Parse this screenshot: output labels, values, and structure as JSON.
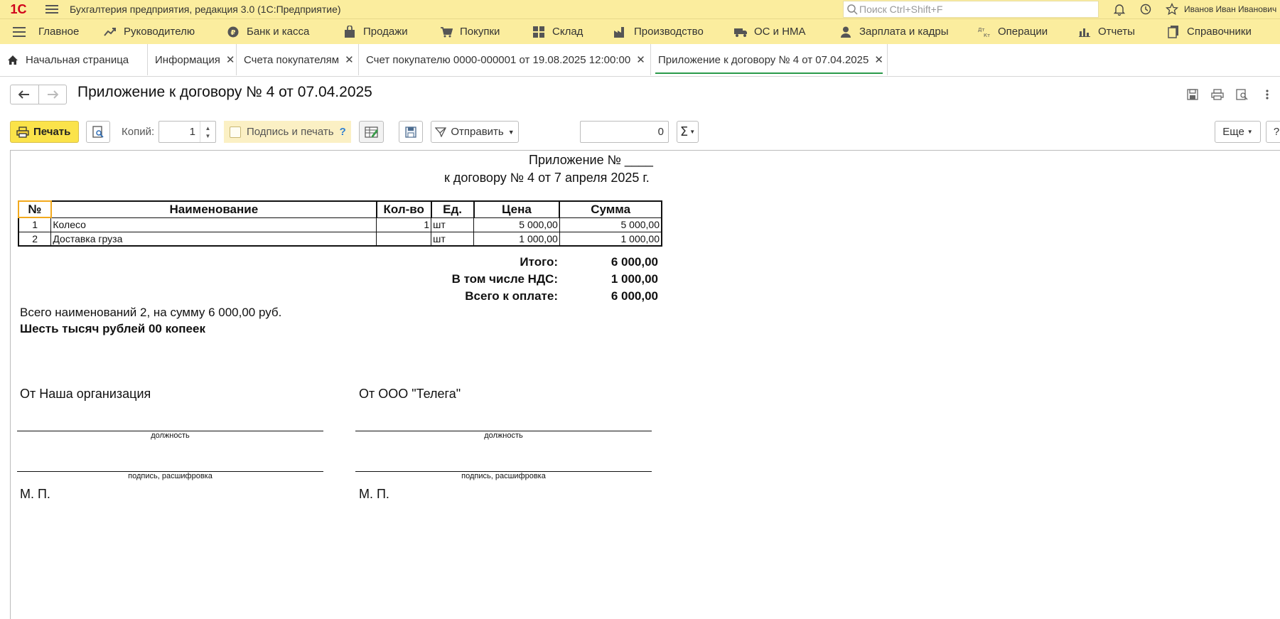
{
  "window": {
    "logo": "1С",
    "title": "Бухгалтерия предприятия, редакция 3.0  (1С:Предприятие)",
    "search_placeholder": "Поиск Ctrl+Shift+F",
    "user": "Иванов Иван Иванович"
  },
  "sections": [
    {
      "label": "Главное",
      "icon": "menu-icon"
    },
    {
      "label": "Руководителю",
      "icon": "trend-icon"
    },
    {
      "label": "Банк и касса",
      "icon": "ruble-coin-icon"
    },
    {
      "label": "Продажи",
      "icon": "shopping-bag-icon"
    },
    {
      "label": "Покупки",
      "icon": "cart-icon"
    },
    {
      "label": "Склад",
      "icon": "warehouse-icon"
    },
    {
      "label": "Производство",
      "icon": "factory-icon"
    },
    {
      "label": "ОС и НМА",
      "icon": "truck-icon"
    },
    {
      "label": "Зарплата и кадры",
      "icon": "person-icon"
    },
    {
      "label": "Операции",
      "icon": "dt-kt-icon"
    },
    {
      "label": "Отчеты",
      "icon": "bar-chart-icon"
    },
    {
      "label": "Справочники",
      "icon": "books-icon"
    }
  ],
  "tabs": [
    {
      "label": "Начальная страница"
    },
    {
      "label": "Информация"
    },
    {
      "label": "Счета покупателям"
    },
    {
      "label": "Счет покупателю 0000-000001 от 19.08.2025 12:00:00"
    },
    {
      "label": "Приложение к договору № 4 от 07.04.2025"
    }
  ],
  "form": {
    "title": "Приложение к договору № 4 от 07.04.2025",
    "print_label": "Печать",
    "copies_label": "Копий:",
    "copies_value": "1",
    "sign_label": "Подпись и печать",
    "sign_help": "?",
    "send_label": "Отправить",
    "sum_value": "0",
    "more_label": "Еще",
    "help_label": "?"
  },
  "document": {
    "title_line1": "Приложение № ____",
    "title_line2": "к договору № 4 от 7 апреля 2025 г.",
    "columns": [
      "№",
      "Наименование",
      "Кол-во",
      "Ед.",
      "Цена",
      "Сумма"
    ],
    "rows": [
      {
        "n": "1",
        "name": "Колесо",
        "qty": "1",
        "unit": "шт",
        "price": "5 000,00",
        "sum": "5 000,00"
      },
      {
        "n": "2",
        "name": "Доставка груза",
        "qty": "",
        "unit": "шт",
        "price": "1 000,00",
        "sum": "1 000,00"
      }
    ],
    "total_label": "Итого:",
    "total_value": "6 000,00",
    "vat_label": "В том числе НДС:",
    "vat_value": "1 000,00",
    "due_label": "Всего к оплате:",
    "due_value": "6 000,00",
    "summary": "Всего наименований 2, на сумму 6 000,00 руб.",
    "summary_words": "Шесть тысяч рублей 00 копеек",
    "party_left": "От Наша организация",
    "party_right": "От ООО \"Телега\"",
    "caption_position": "должность",
    "caption_signature": "подпись, расшифровка",
    "stamp": "М. П."
  }
}
